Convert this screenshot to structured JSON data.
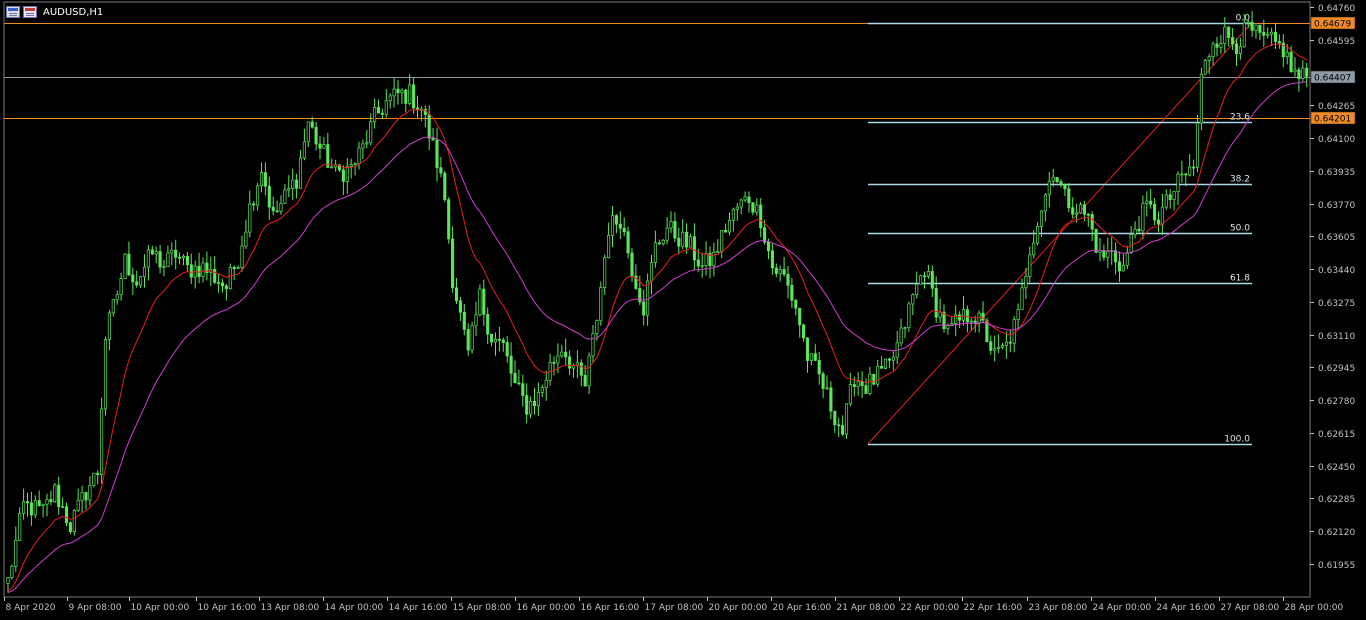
{
  "window": {
    "title": "AUDUSD,H1",
    "icons": [
      "chart-window-icon",
      "symbol-properties-icon"
    ]
  },
  "colors": {
    "background": "#000000",
    "candle": "#5ce65c",
    "ma_fast": "#e62020",
    "ma_slow": "#d23cd2",
    "fib": "#a8d8e8",
    "axis": "#c0c0c0",
    "label_orange": "#f08a24",
    "label_gray": "#8e9aa6"
  },
  "chart_data": {
    "type": "candlestick",
    "symbol": "AUDUSD",
    "timeframe": "H1",
    "y_ticks": [
      "0.64760",
      "0.64595",
      "0.64265",
      "0.64100",
      "0.63935",
      "0.63770",
      "0.63605",
      "0.63440",
      "0.63275",
      "0.63110",
      "0.62945",
      "0.62780",
      "0.62615",
      "0.62450",
      "0.62285",
      "0.62120",
      "0.61955"
    ],
    "ylim": [
      0.6185,
      0.6477
    ],
    "x_ticks": [
      "8 Apr 2020",
      "9 Apr 08:00",
      "10 Apr 00:00",
      "10 Apr 16:00",
      "13 Apr 08:00",
      "14 Apr 00:00",
      "14 Apr 16:00",
      "15 Apr 08:00",
      "16 Apr 00:00",
      "16 Apr 16:00",
      "17 Apr 08:00",
      "20 Apr 00:00",
      "20 Apr 16:00",
      "21 Apr 08:00",
      "22 Apr 00:00",
      "22 Apr 16:00",
      "23 Apr 08:00",
      "24 Apr 00:00",
      "24 Apr 16:00",
      "27 Apr 08:00",
      "28 Apr 00:00"
    ],
    "price_labels": [
      {
        "value": "0.64679",
        "price": 0.64679,
        "style": "orange"
      },
      {
        "value": "0.64407",
        "price": 0.64407,
        "style": "gray"
      },
      {
        "value": "0.64201",
        "price": 0.64201,
        "style": "orange"
      }
    ],
    "horizontal_lines": [
      {
        "price": 0.64679,
        "color": "#f08a24"
      },
      {
        "price": 0.64407,
        "color": "#8e9aa6"
      },
      {
        "price": 0.64201,
        "color": "#f08a24"
      }
    ],
    "fibonacci": {
      "high": 0.6468,
      "low": 0.6256,
      "levels": [
        {
          "label": "0.0",
          "ratio": 0
        },
        {
          "label": "23.6",
          "ratio": 0.236
        },
        {
          "label": "38.2",
          "ratio": 0.382
        },
        {
          "label": "50.0",
          "ratio": 0.5
        },
        {
          "label": "61.8",
          "ratio": 0.618
        },
        {
          "label": "100.0",
          "ratio": 1
        }
      ]
    },
    "series": [
      {
        "role": "price",
        "anchors": [
          [
            0,
            0.6187
          ],
          [
            4,
            0.6225
          ],
          [
            9,
            0.6222
          ],
          [
            12,
            0.6232
          ],
          [
            16,
            0.6215
          ],
          [
            20,
            0.6232
          ],
          [
            23,
            0.6242
          ],
          [
            25,
            0.631
          ],
          [
            28,
            0.6332
          ],
          [
            30,
            0.6348
          ],
          [
            33,
            0.6338
          ],
          [
            37,
            0.6352
          ],
          [
            40,
            0.6346
          ],
          [
            43,
            0.6352
          ],
          [
            46,
            0.6344
          ],
          [
            50,
            0.6345
          ],
          [
            53,
            0.634
          ],
          [
            56,
            0.6335
          ],
          [
            59,
            0.635
          ],
          [
            62,
            0.6375
          ],
          [
            65,
            0.6395
          ],
          [
            68,
            0.637
          ],
          [
            71,
            0.638
          ],
          [
            74,
            0.639
          ],
          [
            77,
            0.6418
          ],
          [
            80,
            0.6405
          ],
          [
            84,
            0.6392
          ],
          [
            88,
            0.6395
          ],
          [
            91,
            0.6405
          ],
          [
            94,
            0.642
          ],
          [
            97,
            0.6428
          ],
          [
            100,
            0.6432
          ],
          [
            103,
            0.6432
          ],
          [
            106,
            0.6425
          ],
          [
            108,
            0.6412
          ],
          [
            110,
            0.6398
          ],
          [
            112,
            0.638
          ],
          [
            114,
            0.634
          ],
          [
            116,
            0.632
          ],
          [
            118,
            0.63
          ],
          [
            121,
            0.633
          ],
          [
            124,
            0.631
          ],
          [
            127,
            0.6305
          ],
          [
            130,
            0.6285
          ],
          [
            133,
            0.6275
          ],
          [
            136,
            0.628
          ],
          [
            139,
            0.6295
          ],
          [
            142,
            0.6305
          ],
          [
            145,
            0.6295
          ],
          [
            148,
            0.6285
          ],
          [
            151,
            0.632
          ],
          [
            154,
            0.6365
          ],
          [
            157,
            0.637
          ],
          [
            160,
            0.6345
          ],
          [
            163,
            0.6325
          ],
          [
            166,
            0.6355
          ],
          [
            169,
            0.6365
          ],
          [
            172,
            0.636
          ],
          [
            175,
            0.6355
          ],
          [
            178,
            0.6345
          ],
          [
            181,
            0.635
          ],
          [
            184,
            0.6365
          ],
          [
            187,
            0.6375
          ],
          [
            190,
            0.638
          ],
          [
            193,
            0.637
          ],
          [
            196,
            0.6345
          ],
          [
            199,
            0.634
          ],
          [
            202,
            0.6325
          ],
          [
            205,
            0.63
          ],
          [
            208,
            0.629
          ],
          [
            211,
            0.6275
          ],
          [
            214,
            0.6262
          ],
          [
            217,
            0.629
          ],
          [
            220,
            0.6285
          ],
          [
            223,
            0.629
          ],
          [
            226,
            0.6295
          ],
          [
            229,
            0.631
          ],
          [
            232,
            0.633
          ],
          [
            235,
            0.6345
          ],
          [
            238,
            0.6325
          ],
          [
            241,
            0.6312
          ],
          [
            244,
            0.6318
          ],
          [
            247,
            0.6322
          ],
          [
            250,
            0.6315
          ],
          [
            253,
            0.63
          ],
          [
            256,
            0.6305
          ],
          [
            259,
            0.632
          ],
          [
            262,
            0.6355
          ],
          [
            265,
            0.6375
          ],
          [
            268,
            0.6395
          ],
          [
            271,
            0.638
          ],
          [
            274,
            0.6375
          ],
          [
            277,
            0.637
          ],
          [
            280,
            0.635
          ],
          [
            283,
            0.6352
          ],
          [
            286,
            0.6345
          ],
          [
            289,
            0.6365
          ],
          [
            292,
            0.6375
          ],
          [
            295,
            0.637
          ],
          [
            298,
            0.638
          ],
          [
            301,
            0.639
          ],
          [
            304,
            0.6395
          ],
          [
            306,
            0.644
          ],
          [
            309,
            0.646
          ],
          [
            312,
            0.6462
          ],
          [
            315,
            0.6458
          ],
          [
            318,
            0.6465
          ],
          [
            321,
            0.646
          ],
          [
            324,
            0.6458
          ],
          [
            327,
            0.6455
          ],
          [
            329,
            0.6445
          ],
          [
            331,
            0.644
          ]
        ]
      },
      {
        "role": "moving-average-fast",
        "period": 14
      },
      {
        "role": "moving-average-slow",
        "period": 34
      }
    ]
  }
}
